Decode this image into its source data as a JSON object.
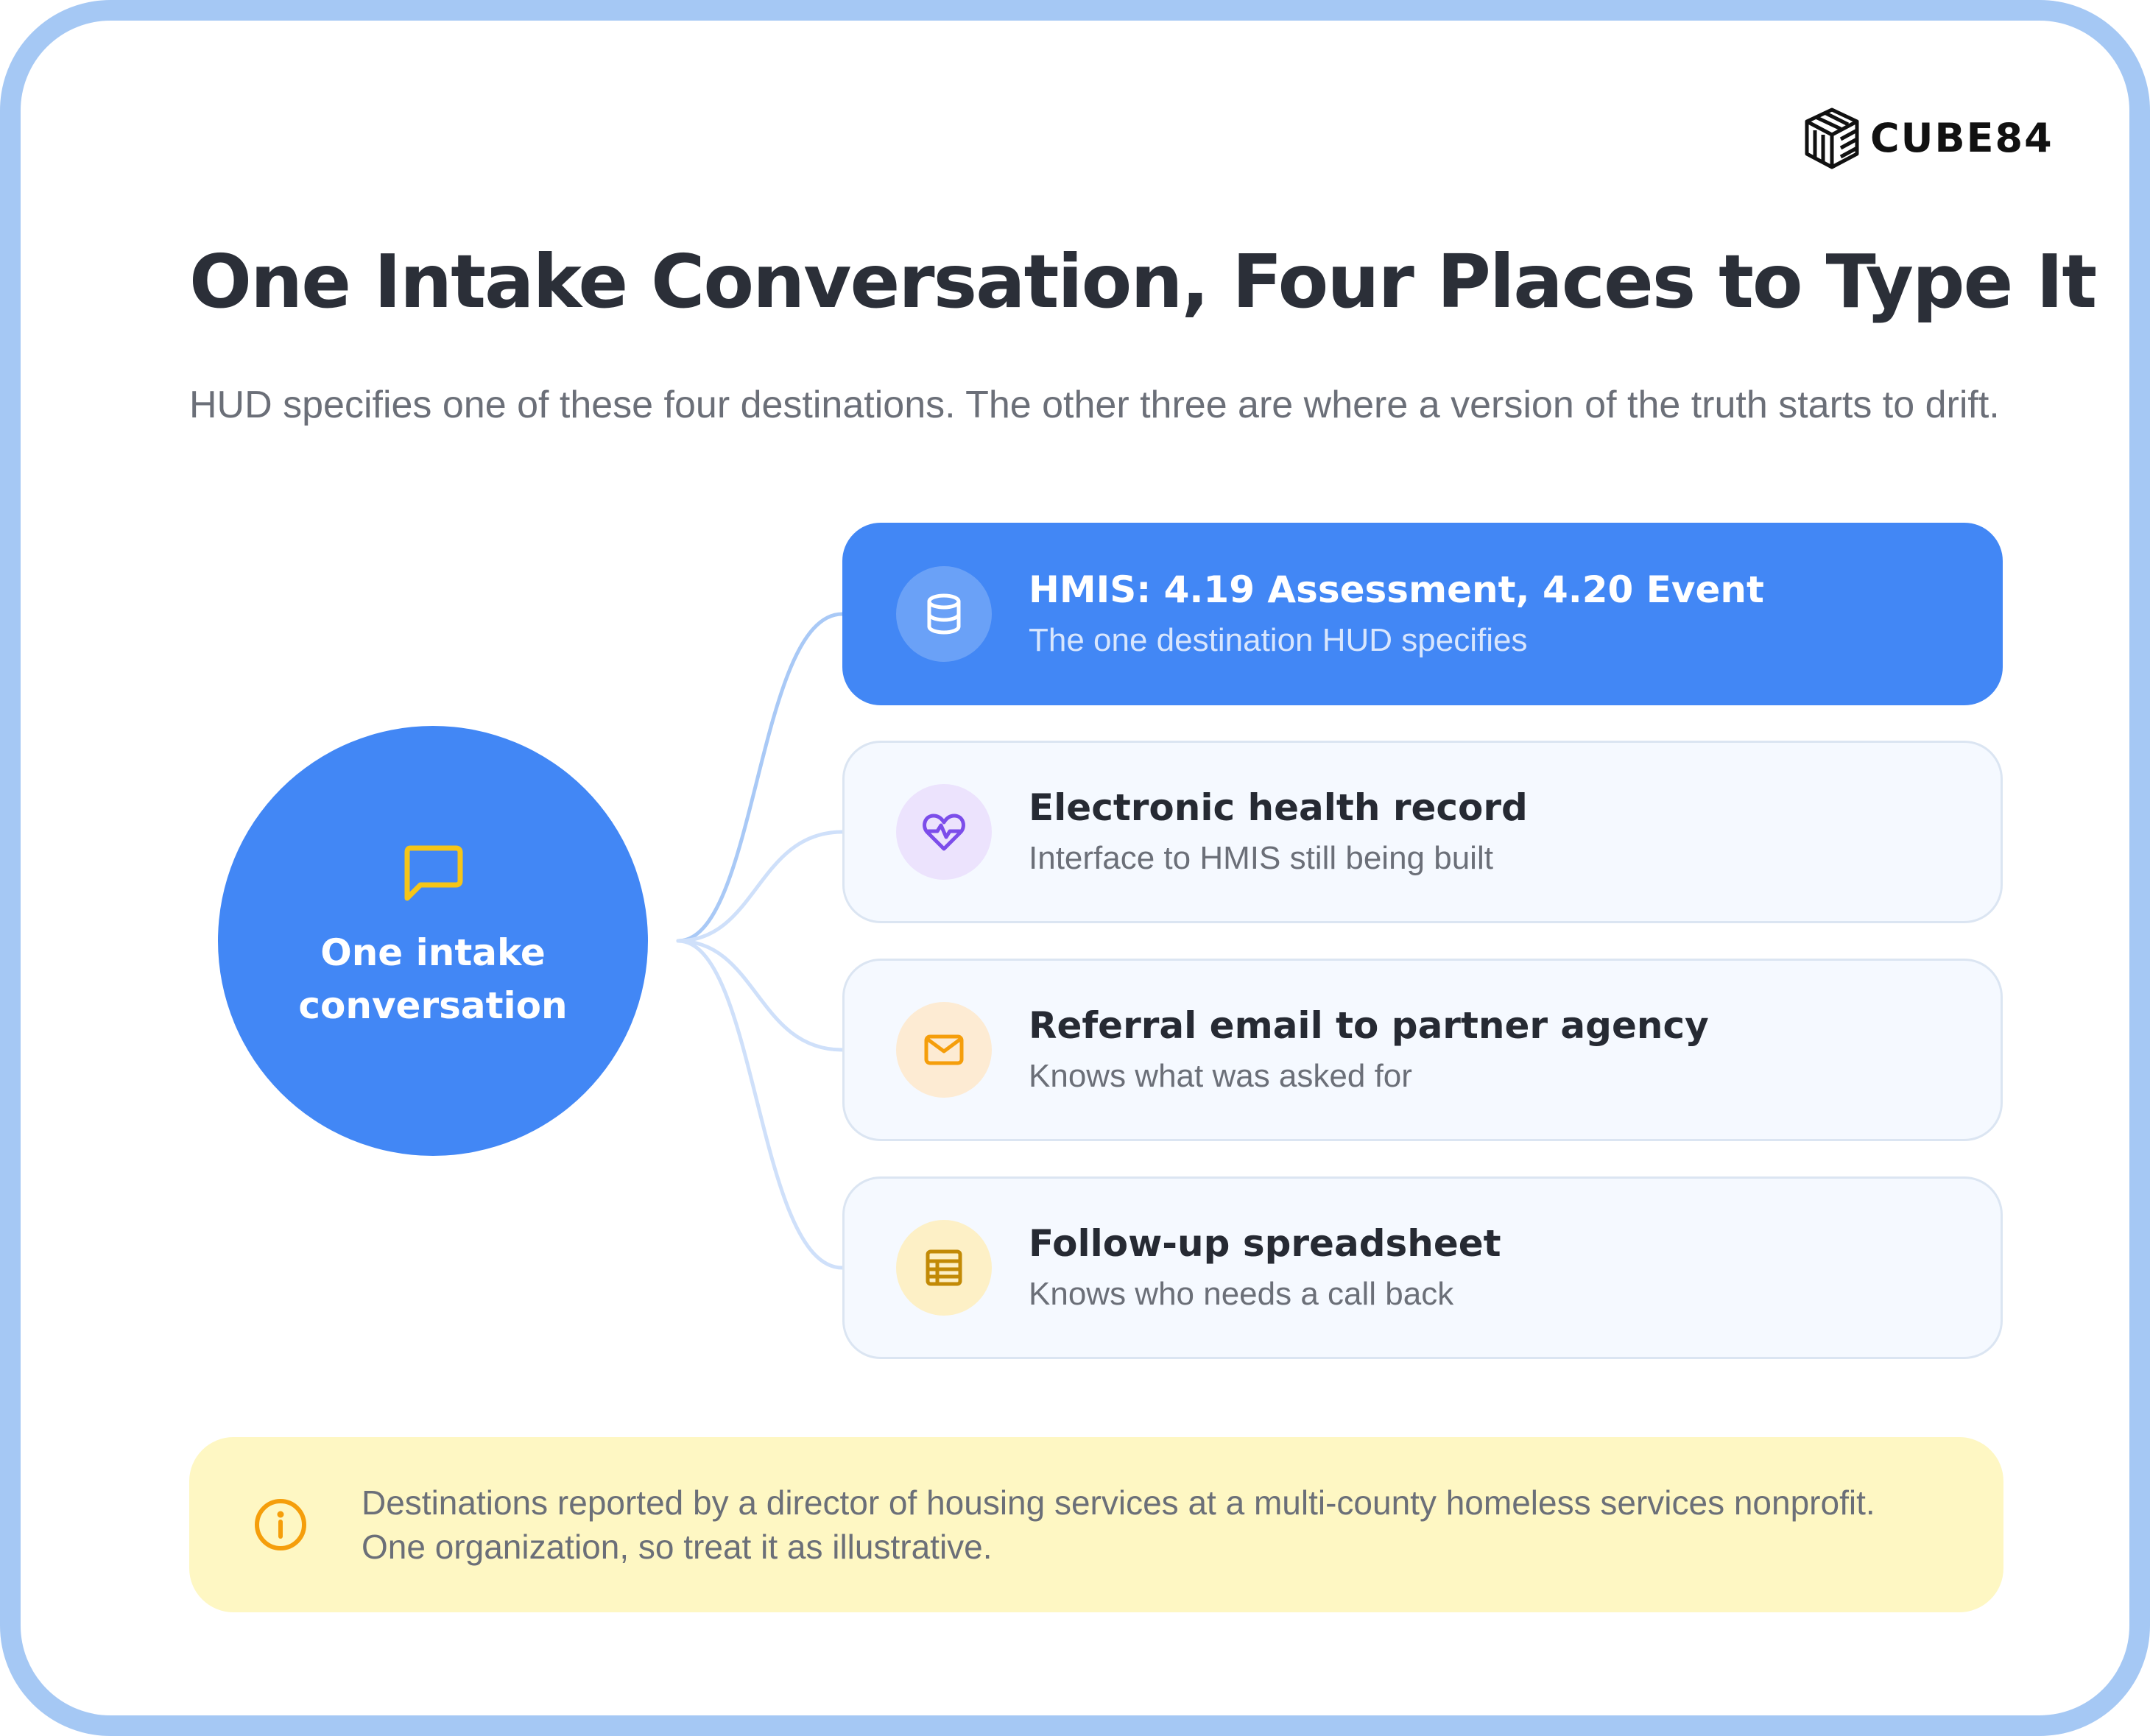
{
  "brand": {
    "name": "CUBE84",
    "logo_icon": "cube-lines-logo"
  },
  "header": {
    "title": "One Intake Conversation, Four Places to Type It",
    "subtitle": "HUD specifies one of these four destinations. The other three are where a version of the truth starts to drift."
  },
  "hub": {
    "icon": "chat-bubble-icon",
    "label": "One intake conversation",
    "color": "#4287f5",
    "icon_color": "#f5c518"
  },
  "destinations": [
    {
      "title": "HMIS: 4.19 Assessment, 4.20 Event",
      "description": "The one destination HUD specifies",
      "icon": "database-icon",
      "highlighted": true,
      "accent": "#ffffff"
    },
    {
      "title": "Electronic health record",
      "description": "Interface to HMIS still being built",
      "icon": "heartbeat-icon",
      "highlighted": false,
      "accent": "#7c4dea"
    },
    {
      "title": "Referral email to partner agency",
      "description": "Knows what was asked for",
      "icon": "mail-icon",
      "highlighted": false,
      "accent": "#f59e0b"
    },
    {
      "title": "Follow-up spreadsheet",
      "description": "Knows who needs a call back",
      "icon": "spreadsheet-icon",
      "highlighted": false,
      "accent": "#c28a06"
    }
  ],
  "footnote": {
    "icon": "info-icon",
    "lines": [
      "Destinations reported by a director of housing services at a multi-county homeless services nonprofit.",
      "One organization, so treat it as illustrative."
    ]
  }
}
